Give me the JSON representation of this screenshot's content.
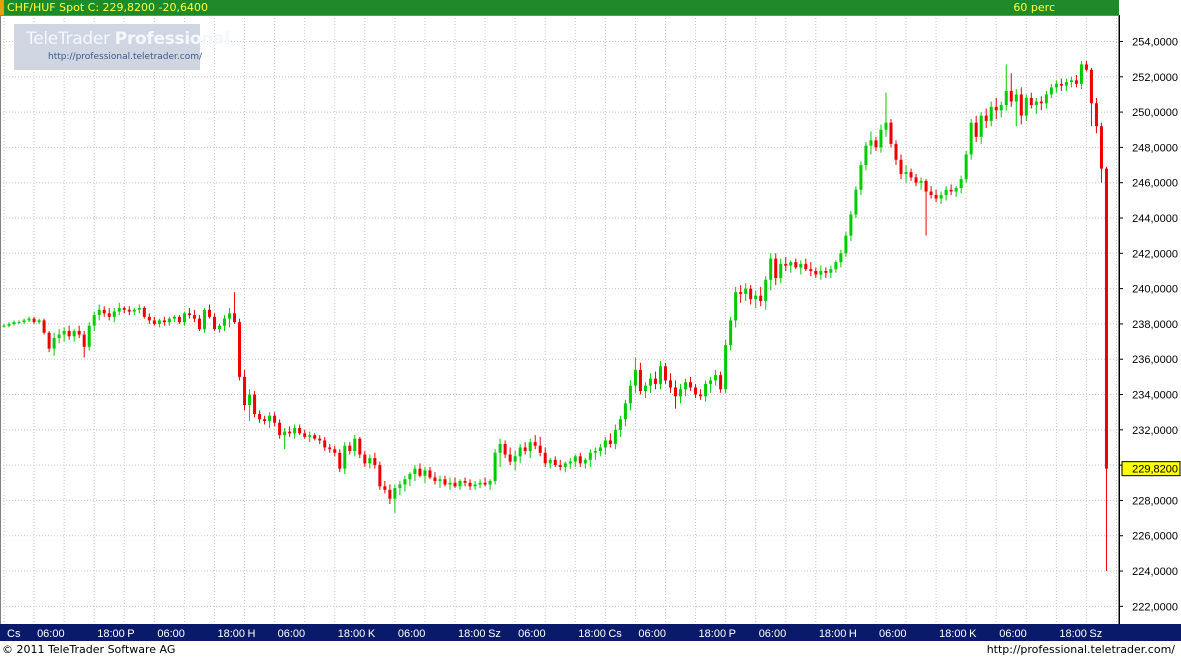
{
  "header": {
    "symbol": "CHF/HUF Spot",
    "close_label": "C: 229,8200",
    "change": "-20,6400",
    "interval": "60 perc"
  },
  "logo": {
    "name_light": "TeleTrader ",
    "name_bold": "Professional",
    "url": "http://professional.teletrader.com/"
  },
  "footer": {
    "copyright": "© 2011  TeleTrader Software AG",
    "url": "http://professional.teletrader.com/"
  },
  "colors": {
    "up": "#00cc00",
    "down": "#ee0000",
    "header_bg": "#1e8a28",
    "header_text": "#ffff40",
    "axis_bg": "#0a1a6a",
    "last_price_bg": "#ffff00"
  },
  "chart_data": {
    "type": "candlestick",
    "title": "CHF/HUF Spot",
    "interval": "60 perc",
    "last_price": "229,8200",
    "change": "-20,6400",
    "ylim": [
      221,
      255.5
    ],
    "y_ticks": [
      "222,0000",
      "224,0000",
      "226,0000",
      "228,0000",
      "230,0000",
      "232,0000",
      "234,0000",
      "236,0000",
      "238,0000",
      "240,0000",
      "242,0000",
      "244,0000",
      "246,0000",
      "248,0000",
      "250,0000",
      "252,0000",
      "254,0000"
    ],
    "y_tick_values": [
      222,
      224,
      226,
      228,
      230,
      232,
      234,
      236,
      238,
      240,
      242,
      244,
      246,
      248,
      250,
      252,
      254
    ],
    "x_ticks": [
      {
        "label": "Cs",
        "bar": 0
      },
      {
        "label": "06:00",
        "bar": 6
      },
      {
        "label": "18:00",
        "bar": 18
      },
      {
        "label": "P",
        "bar": 24
      },
      {
        "label": "06:00",
        "bar": 30
      },
      {
        "label": "18:00",
        "bar": 42
      },
      {
        "label": "H",
        "bar": 48
      },
      {
        "label": "06:00",
        "bar": 54
      },
      {
        "label": "18:00",
        "bar": 66
      },
      {
        "label": "K",
        "bar": 72
      },
      {
        "label": "06:00",
        "bar": 78
      },
      {
        "label": "18:00",
        "bar": 90
      },
      {
        "label": "Sz",
        "bar": 96
      },
      {
        "label": "06:00",
        "bar": 102
      },
      {
        "label": "18:00",
        "bar": 114
      },
      {
        "label": "Cs",
        "bar": 120
      },
      {
        "label": "06:00",
        "bar": 126
      },
      {
        "label": "18:00",
        "bar": 138
      },
      {
        "label": "P",
        "bar": 144
      },
      {
        "label": "06:00",
        "bar": 150
      },
      {
        "label": "18:00",
        "bar": 162
      },
      {
        "label": "H",
        "bar": 168
      },
      {
        "label": "06:00",
        "bar": 174
      },
      {
        "label": "18:00",
        "bar": 186
      },
      {
        "label": "K",
        "bar": 192
      },
      {
        "label": "06:00",
        "bar": 198
      },
      {
        "label": "18:00",
        "bar": 210
      },
      {
        "label": "Sz",
        "bar": 216
      }
    ],
    "xlim": [
      -0.8,
      222.5
    ],
    "bars": [
      [
        237.9,
        238.0,
        237.8,
        237.9
      ],
      [
        237.9,
        238.1,
        237.8,
        238.0
      ],
      [
        238.0,
        238.2,
        237.9,
        238.1
      ],
      [
        238.1,
        238.2,
        238.0,
        238.1
      ],
      [
        238.1,
        238.3,
        238.0,
        238.2
      ],
      [
        238.2,
        238.4,
        238.1,
        238.3
      ],
      [
        238.3,
        238.4,
        238.0,
        238.1
      ],
      [
        238.1,
        238.3,
        238.0,
        238.2
      ],
      [
        238.2,
        238.3,
        237.4,
        237.5
      ],
      [
        237.5,
        237.6,
        236.4,
        236.6
      ],
      [
        236.6,
        237.5,
        236.2,
        237.2
      ],
      [
        237.2,
        237.7,
        236.9,
        237.4
      ],
      [
        237.4,
        237.8,
        237.0,
        237.6
      ],
      [
        237.6,
        237.9,
        237.1,
        237.3
      ],
      [
        237.3,
        237.7,
        237.0,
        237.6
      ],
      [
        237.6,
        237.9,
        237.2,
        237.4
      ],
      [
        237.4,
        237.6,
        236.1,
        236.7
      ],
      [
        236.7,
        238.1,
        236.5,
        237.9
      ],
      [
        237.9,
        238.7,
        237.6,
        238.5
      ],
      [
        238.5,
        239.1,
        238.2,
        238.8
      ],
      [
        238.8,
        239.0,
        238.4,
        238.6
      ],
      [
        238.6,
        238.9,
        238.2,
        238.4
      ],
      [
        238.4,
        238.9,
        238.1,
        238.7
      ],
      [
        238.7,
        239.2,
        238.5,
        238.9
      ],
      [
        238.9,
        239.0,
        238.6,
        238.8
      ],
      [
        238.8,
        239.0,
        238.5,
        238.7
      ],
      [
        238.7,
        238.9,
        238.5,
        238.8
      ],
      [
        238.8,
        239.1,
        238.6,
        238.9
      ],
      [
        238.9,
        239.0,
        238.3,
        238.4
      ],
      [
        238.4,
        238.6,
        238.0,
        238.2
      ],
      [
        238.2,
        238.4,
        237.9,
        238.0
      ],
      [
        238.0,
        238.3,
        237.8,
        238.2
      ],
      [
        238.2,
        238.4,
        237.9,
        238.1
      ],
      [
        238.1,
        238.4,
        237.9,
        238.3
      ],
      [
        238.3,
        238.5,
        238.1,
        238.4
      ],
      [
        238.4,
        238.5,
        238.0,
        238.1
      ],
      [
        238.1,
        238.7,
        237.9,
        238.6
      ],
      [
        238.6,
        238.9,
        238.3,
        238.5
      ],
      [
        238.5,
        238.8,
        238.1,
        238.3
      ],
      [
        238.3,
        238.5,
        237.6,
        237.7
      ],
      [
        237.7,
        238.9,
        237.5,
        238.8
      ],
      [
        238.8,
        239.1,
        238.3,
        238.4
      ],
      [
        238.4,
        238.6,
        237.6,
        237.7
      ],
      [
        237.7,
        238.0,
        237.5,
        237.9
      ],
      [
        237.9,
        238.5,
        237.6,
        238.3
      ],
      [
        238.3,
        238.9,
        237.8,
        238.6
      ],
      [
        238.6,
        239.8,
        238.0,
        238.1
      ],
      [
        238.1,
        238.3,
        234.8,
        235.0
      ],
      [
        235.0,
        235.4,
        233.1,
        233.4
      ],
      [
        233.4,
        234.3,
        232.5,
        234.0
      ],
      [
        234.0,
        234.2,
        232.7,
        232.9
      ],
      [
        232.9,
        233.1,
        232.4,
        232.6
      ],
      [
        232.6,
        232.8,
        232.3,
        232.5
      ],
      [
        232.5,
        233.0,
        232.1,
        232.8
      ],
      [
        232.8,
        233.0,
        232.2,
        232.4
      ],
      [
        232.4,
        232.6,
        231.5,
        231.7
      ],
      [
        231.7,
        232.1,
        230.9,
        231.9
      ],
      [
        231.9,
        232.2,
        231.6,
        231.8
      ],
      [
        231.8,
        232.3,
        231.5,
        232.1
      ],
      [
        232.1,
        232.3,
        231.7,
        231.8
      ],
      [
        231.8,
        232.0,
        231.5,
        231.6
      ],
      [
        231.6,
        231.9,
        231.3,
        231.7
      ],
      [
        231.7,
        231.8,
        231.4,
        231.5
      ],
      [
        231.5,
        231.7,
        231.2,
        231.4
      ],
      [
        231.4,
        231.6,
        230.8,
        231.0
      ],
      [
        231.0,
        231.2,
        230.7,
        230.9
      ],
      [
        230.9,
        231.1,
        230.5,
        230.7
      ],
      [
        230.7,
        230.9,
        229.6,
        229.8
      ],
      [
        229.8,
        231.3,
        229.5,
        231.1
      ],
      [
        231.1,
        231.3,
        230.6,
        230.8
      ],
      [
        230.8,
        231.7,
        230.5,
        231.5
      ],
      [
        231.5,
        231.6,
        230.4,
        230.6
      ],
      [
        230.6,
        230.8,
        229.9,
        230.1
      ],
      [
        230.1,
        230.6,
        229.8,
        230.4
      ],
      [
        230.4,
        230.7,
        229.8,
        230.0
      ],
      [
        230.0,
        230.2,
        228.6,
        228.8
      ],
      [
        228.8,
        229.1,
        228.4,
        228.6
      ],
      [
        228.6,
        228.9,
        227.8,
        228.1
      ],
      [
        228.1,
        228.9,
        227.3,
        228.7
      ],
      [
        228.7,
        229.1,
        228.3,
        228.9
      ],
      [
        228.9,
        229.4,
        228.5,
        229.2
      ],
      [
        229.2,
        229.6,
        228.8,
        229.5
      ],
      [
        229.5,
        230.0,
        229.1,
        229.8
      ],
      [
        229.8,
        230.1,
        229.3,
        229.4
      ],
      [
        229.4,
        229.9,
        229.0,
        229.7
      ],
      [
        229.7,
        229.9,
        229.2,
        229.3
      ],
      [
        229.3,
        229.6,
        228.9,
        229.1
      ],
      [
        229.1,
        229.4,
        228.7,
        229.2
      ],
      [
        229.2,
        229.4,
        228.8,
        228.9
      ],
      [
        228.9,
        229.3,
        228.6,
        229.0
      ],
      [
        229.0,
        229.3,
        228.7,
        228.8
      ],
      [
        228.8,
        229.2,
        228.6,
        229.1
      ],
      [
        229.1,
        229.3,
        228.8,
        229.0
      ],
      [
        229.0,
        229.2,
        228.6,
        228.8
      ],
      [
        228.8,
        229.1,
        228.6,
        228.9
      ],
      [
        228.9,
        229.2,
        228.7,
        229.0
      ],
      [
        229.0,
        229.3,
        228.8,
        228.9
      ],
      [
        228.9,
        229.2,
        228.6,
        229.1
      ],
      [
        229.1,
        230.9,
        228.9,
        230.7
      ],
      [
        230.7,
        231.5,
        229.9,
        231.2
      ],
      [
        231.2,
        231.4,
        230.4,
        230.6
      ],
      [
        230.6,
        231.0,
        230.0,
        230.2
      ],
      [
        230.2,
        230.8,
        229.7,
        230.5
      ],
      [
        230.5,
        231.2,
        230.1,
        231.0
      ],
      [
        231.0,
        231.3,
        230.6,
        230.8
      ],
      [
        230.8,
        231.5,
        230.4,
        231.3
      ],
      [
        231.3,
        231.7,
        230.9,
        231.1
      ],
      [
        231.1,
        231.6,
        230.5,
        230.7
      ],
      [
        230.7,
        231.0,
        229.9,
        230.1
      ],
      [
        230.1,
        230.4,
        229.8,
        230.3
      ],
      [
        230.3,
        230.5,
        229.9,
        230.0
      ],
      [
        230.0,
        230.3,
        229.7,
        229.9
      ],
      [
        229.9,
        230.2,
        229.6,
        230.1
      ],
      [
        230.1,
        230.4,
        229.8,
        230.2
      ],
      [
        230.2,
        230.6,
        229.9,
        230.5
      ],
      [
        230.5,
        230.7,
        229.9,
        230.1
      ],
      [
        230.1,
        230.4,
        229.8,
        230.3
      ],
      [
        230.3,
        230.9,
        229.9,
        230.7
      ],
      [
        230.7,
        231.0,
        230.3,
        230.8
      ],
      [
        230.8,
        231.2,
        230.5,
        231.0
      ],
      [
        231.0,
        231.6,
        230.6,
        231.4
      ],
      [
        231.4,
        231.8,
        231.0,
        231.2
      ],
      [
        231.2,
        232.3,
        230.9,
        232.0
      ],
      [
        232.0,
        232.8,
        231.6,
        232.6
      ],
      [
        232.6,
        233.7,
        232.2,
        233.5
      ],
      [
        233.5,
        234.8,
        233.1,
        234.5
      ],
      [
        234.5,
        236.1,
        234.1,
        235.4
      ],
      [
        235.4,
        235.8,
        234.0,
        234.2
      ],
      [
        234.2,
        234.7,
        233.8,
        234.5
      ],
      [
        234.5,
        235.2,
        234.1,
        234.9
      ],
      [
        234.9,
        235.3,
        234.3,
        234.6
      ],
      [
        234.6,
        235.9,
        234.3,
        235.6
      ],
      [
        235.6,
        235.8,
        234.6,
        234.8
      ],
      [
        234.8,
        235.2,
        234.1,
        234.4
      ],
      [
        234.4,
        234.8,
        233.2,
        233.9
      ],
      [
        233.9,
        234.6,
        233.5,
        234.3
      ],
      [
        234.3,
        234.9,
        233.9,
        234.7
      ],
      [
        234.7,
        235.0,
        234.2,
        234.4
      ],
      [
        234.4,
        234.6,
        233.8,
        234.0
      ],
      [
        234.0,
        234.3,
        233.7,
        233.9
      ],
      [
        233.9,
        234.8,
        233.6,
        234.6
      ],
      [
        234.6,
        235.0,
        234.1,
        234.8
      ],
      [
        234.8,
        235.4,
        234.5,
        235.1
      ],
      [
        235.1,
        235.3,
        234.1,
        234.3
      ],
      [
        234.3,
        237.1,
        234.1,
        236.8
      ],
      [
        236.8,
        238.4,
        236.5,
        238.2
      ],
      [
        238.2,
        240.1,
        237.8,
        239.8
      ],
      [
        239.8,
        240.2,
        239.2,
        239.7
      ],
      [
        239.7,
        240.3,
        239.3,
        240.0
      ],
      [
        240.0,
        240.2,
        239.1,
        239.4
      ],
      [
        239.4,
        239.9,
        238.9,
        239.6
      ],
      [
        239.6,
        240.1,
        239.0,
        239.3
      ],
      [
        239.3,
        240.7,
        238.8,
        240.5
      ],
      [
        240.5,
        242.0,
        239.9,
        241.7
      ],
      [
        241.7,
        242.0,
        240.2,
        240.6
      ],
      [
        240.6,
        241.7,
        240.3,
        241.4
      ],
      [
        241.4,
        241.8,
        241.0,
        241.3
      ],
      [
        241.3,
        241.6,
        240.9,
        241.5
      ],
      [
        241.5,
        241.7,
        241.1,
        241.2
      ],
      [
        241.2,
        241.6,
        240.8,
        241.4
      ],
      [
        241.4,
        241.7,
        241.0,
        241.1
      ],
      [
        241.1,
        241.5,
        240.7,
        241.0
      ],
      [
        241.0,
        241.2,
        240.6,
        240.8
      ],
      [
        240.8,
        241.3,
        240.5,
        241.0
      ],
      [
        241.0,
        241.2,
        240.6,
        240.9
      ],
      [
        240.9,
        241.3,
        240.6,
        241.1
      ],
      [
        241.1,
        241.6,
        240.9,
        241.5
      ],
      [
        241.5,
        242.2,
        241.2,
        242.0
      ],
      [
        242.0,
        243.2,
        241.8,
        243.0
      ],
      [
        243.0,
        244.4,
        242.7,
        244.2
      ],
      [
        244.2,
        245.8,
        244.0,
        245.6
      ],
      [
        245.6,
        247.2,
        245.3,
        247.0
      ],
      [
        247.0,
        248.3,
        246.7,
        248.1
      ],
      [
        248.1,
        248.9,
        247.6,
        248.4
      ],
      [
        248.4,
        248.6,
        247.8,
        248.0
      ],
      [
        248.0,
        249.3,
        247.7,
        249.0
      ],
      [
        249.0,
        251.1,
        248.6,
        249.4
      ],
      [
        249.4,
        249.6,
        248.0,
        248.2
      ],
      [
        248.2,
        248.4,
        247.0,
        247.3
      ],
      [
        247.3,
        247.6,
        246.2,
        246.5
      ],
      [
        246.5,
        247.0,
        246.0,
        246.6
      ],
      [
        246.6,
        246.8,
        246.1,
        246.3
      ],
      [
        246.3,
        246.5,
        245.8,
        246.0
      ],
      [
        246.0,
        246.3,
        245.6,
        246.1
      ],
      [
        246.1,
        246.2,
        243.0,
        245.5
      ],
      [
        245.5,
        245.8,
        245.1,
        245.3
      ],
      [
        245.3,
        245.6,
        244.9,
        245.1
      ],
      [
        245.1,
        245.5,
        244.8,
        245.3
      ],
      [
        245.3,
        245.8,
        245.0,
        245.6
      ],
      [
        245.6,
        245.9,
        245.3,
        245.5
      ],
      [
        245.5,
        245.8,
        245.2,
        245.7
      ],
      [
        245.7,
        246.4,
        245.4,
        246.2
      ],
      [
        246.2,
        247.8,
        246.0,
        247.6
      ],
      [
        247.6,
        249.6,
        247.3,
        249.4
      ],
      [
        249.4,
        249.8,
        248.3,
        248.6
      ],
      [
        248.6,
        250.0,
        248.2,
        249.8
      ],
      [
        249.8,
        250.2,
        249.1,
        249.5
      ],
      [
        249.5,
        250.6,
        249.2,
        250.3
      ],
      [
        250.3,
        250.8,
        249.6,
        250.1
      ],
      [
        250.1,
        250.6,
        249.7,
        250.4
      ],
      [
        250.4,
        252.7,
        250.1,
        251.2
      ],
      [
        251.2,
        252.2,
        250.3,
        250.6
      ],
      [
        250.6,
        251.3,
        249.2,
        251.0
      ],
      [
        251.0,
        251.4,
        249.3,
        249.8
      ],
      [
        249.8,
        251.0,
        249.5,
        250.8
      ],
      [
        250.8,
        251.1,
        250.2,
        250.4
      ],
      [
        250.4,
        250.8,
        249.9,
        250.6
      ],
      [
        250.6,
        250.9,
        250.1,
        250.5
      ],
      [
        250.5,
        251.2,
        250.2,
        251.0
      ],
      [
        251.0,
        251.6,
        250.8,
        251.4
      ],
      [
        251.4,
        251.8,
        251.1,
        251.6
      ],
      [
        251.6,
        251.9,
        251.2,
        251.5
      ],
      [
        251.5,
        251.9,
        251.2,
        251.7
      ],
      [
        251.7,
        252.0,
        251.4,
        251.8
      ],
      [
        251.8,
        252.1,
        251.4,
        251.6
      ],
      [
        251.6,
        252.9,
        251.3,
        252.7
      ],
      [
        252.7,
        252.9,
        252.3,
        252.4
      ],
      [
        252.4,
        252.5,
        249.2,
        250.5
      ],
      [
        250.5,
        250.8,
        248.8,
        249.2
      ],
      [
        249.2,
        249.4,
        246.0,
        246.8
      ],
      [
        246.8,
        246.9,
        224.0,
        229.8
      ]
    ]
  }
}
